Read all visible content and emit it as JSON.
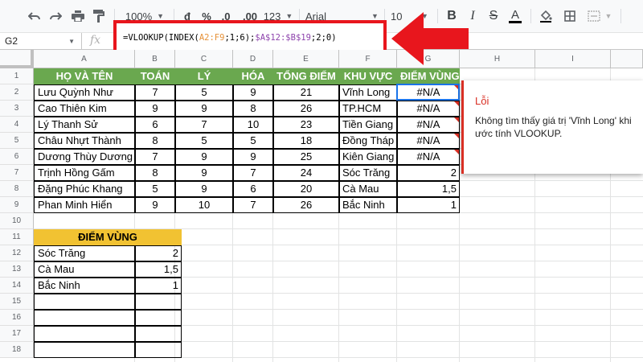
{
  "toolbar": {
    "zoom": "100%",
    "currency": "đ",
    "percent": "%",
    "decrease_decimals": ".0",
    "increase_decimals": ".00",
    "more_formats": "123",
    "font": "Arial",
    "font_size": "10"
  },
  "formula_bar": {
    "cell_ref": "G2",
    "fx": "fx",
    "formula_parts": [
      {
        "text": "=VLOOKUP(INDEX(",
        "color": "plain"
      },
      {
        "text": "A2:F9",
        "color": "orange"
      },
      {
        "text": ";1;6);",
        "color": "plain"
      },
      {
        "text": "$A$12:$B$19",
        "color": "purple"
      },
      {
        "text": ";2;0)",
        "color": "plain"
      }
    ]
  },
  "grid": {
    "columns": [
      "A",
      "B",
      "C",
      "D",
      "E",
      "F",
      "G",
      "H",
      "I"
    ],
    "rows": [
      "1",
      "2",
      "3",
      "4",
      "5",
      "6",
      "7",
      "8",
      "9",
      "10",
      "11",
      "12",
      "13",
      "14",
      "15",
      "16",
      "17",
      "18"
    ],
    "table1": {
      "headers": [
        "HỌ VÀ TÊN",
        "TOÁN",
        "LÝ",
        "HÓA",
        "TỔNG ĐIỂM",
        "KHU VỰC",
        "ĐIỂM VÙNG"
      ],
      "rows": [
        [
          "Lưu Quỳnh Như",
          "7",
          "5",
          "9",
          "21",
          "Vĩnh Long",
          "#N/A"
        ],
        [
          "Cao Thiên Kim",
          "9",
          "9",
          "8",
          "26",
          "TP.HCM",
          "#N/A"
        ],
        [
          "Lý Thanh Sử",
          "6",
          "7",
          "10",
          "23",
          "Tiền Giang",
          "#N/A"
        ],
        [
          "Châu Nhựt Thành",
          "8",
          "5",
          "5",
          "18",
          "Đồng Tháp",
          "#N/A"
        ],
        [
          "Dương Thùy Dương",
          "7",
          "9",
          "9",
          "25",
          "Kiên Giang",
          "#N/A"
        ],
        [
          "Trịnh Hồng Gấm",
          "8",
          "9",
          "7",
          "24",
          "Sóc Trăng",
          "2"
        ],
        [
          "Đặng Phúc Khang",
          "5",
          "9",
          "6",
          "20",
          "Cà Mau",
          "1,5"
        ],
        [
          "Phan Minh Hiển",
          "9",
          "10",
          "7",
          "26",
          "Bắc Ninh",
          "1"
        ]
      ]
    },
    "table2": {
      "header": "ĐIỂM VÙNG",
      "rows": [
        [
          "Sóc Trăng",
          "2"
        ],
        [
          "Cà Mau",
          "1,5"
        ],
        [
          "Bắc Ninh",
          "1"
        ]
      ]
    }
  },
  "tooltip": {
    "title": "Lỗi",
    "message": "Không tìm thấy giá trị 'Vĩnh Long' khi ước tính VLOOKUP."
  },
  "colors": {
    "header_green": "#6aa84f",
    "header_yellow": "#f1c232",
    "highlight_red": "#e8161d",
    "error_red": "#d93025"
  }
}
